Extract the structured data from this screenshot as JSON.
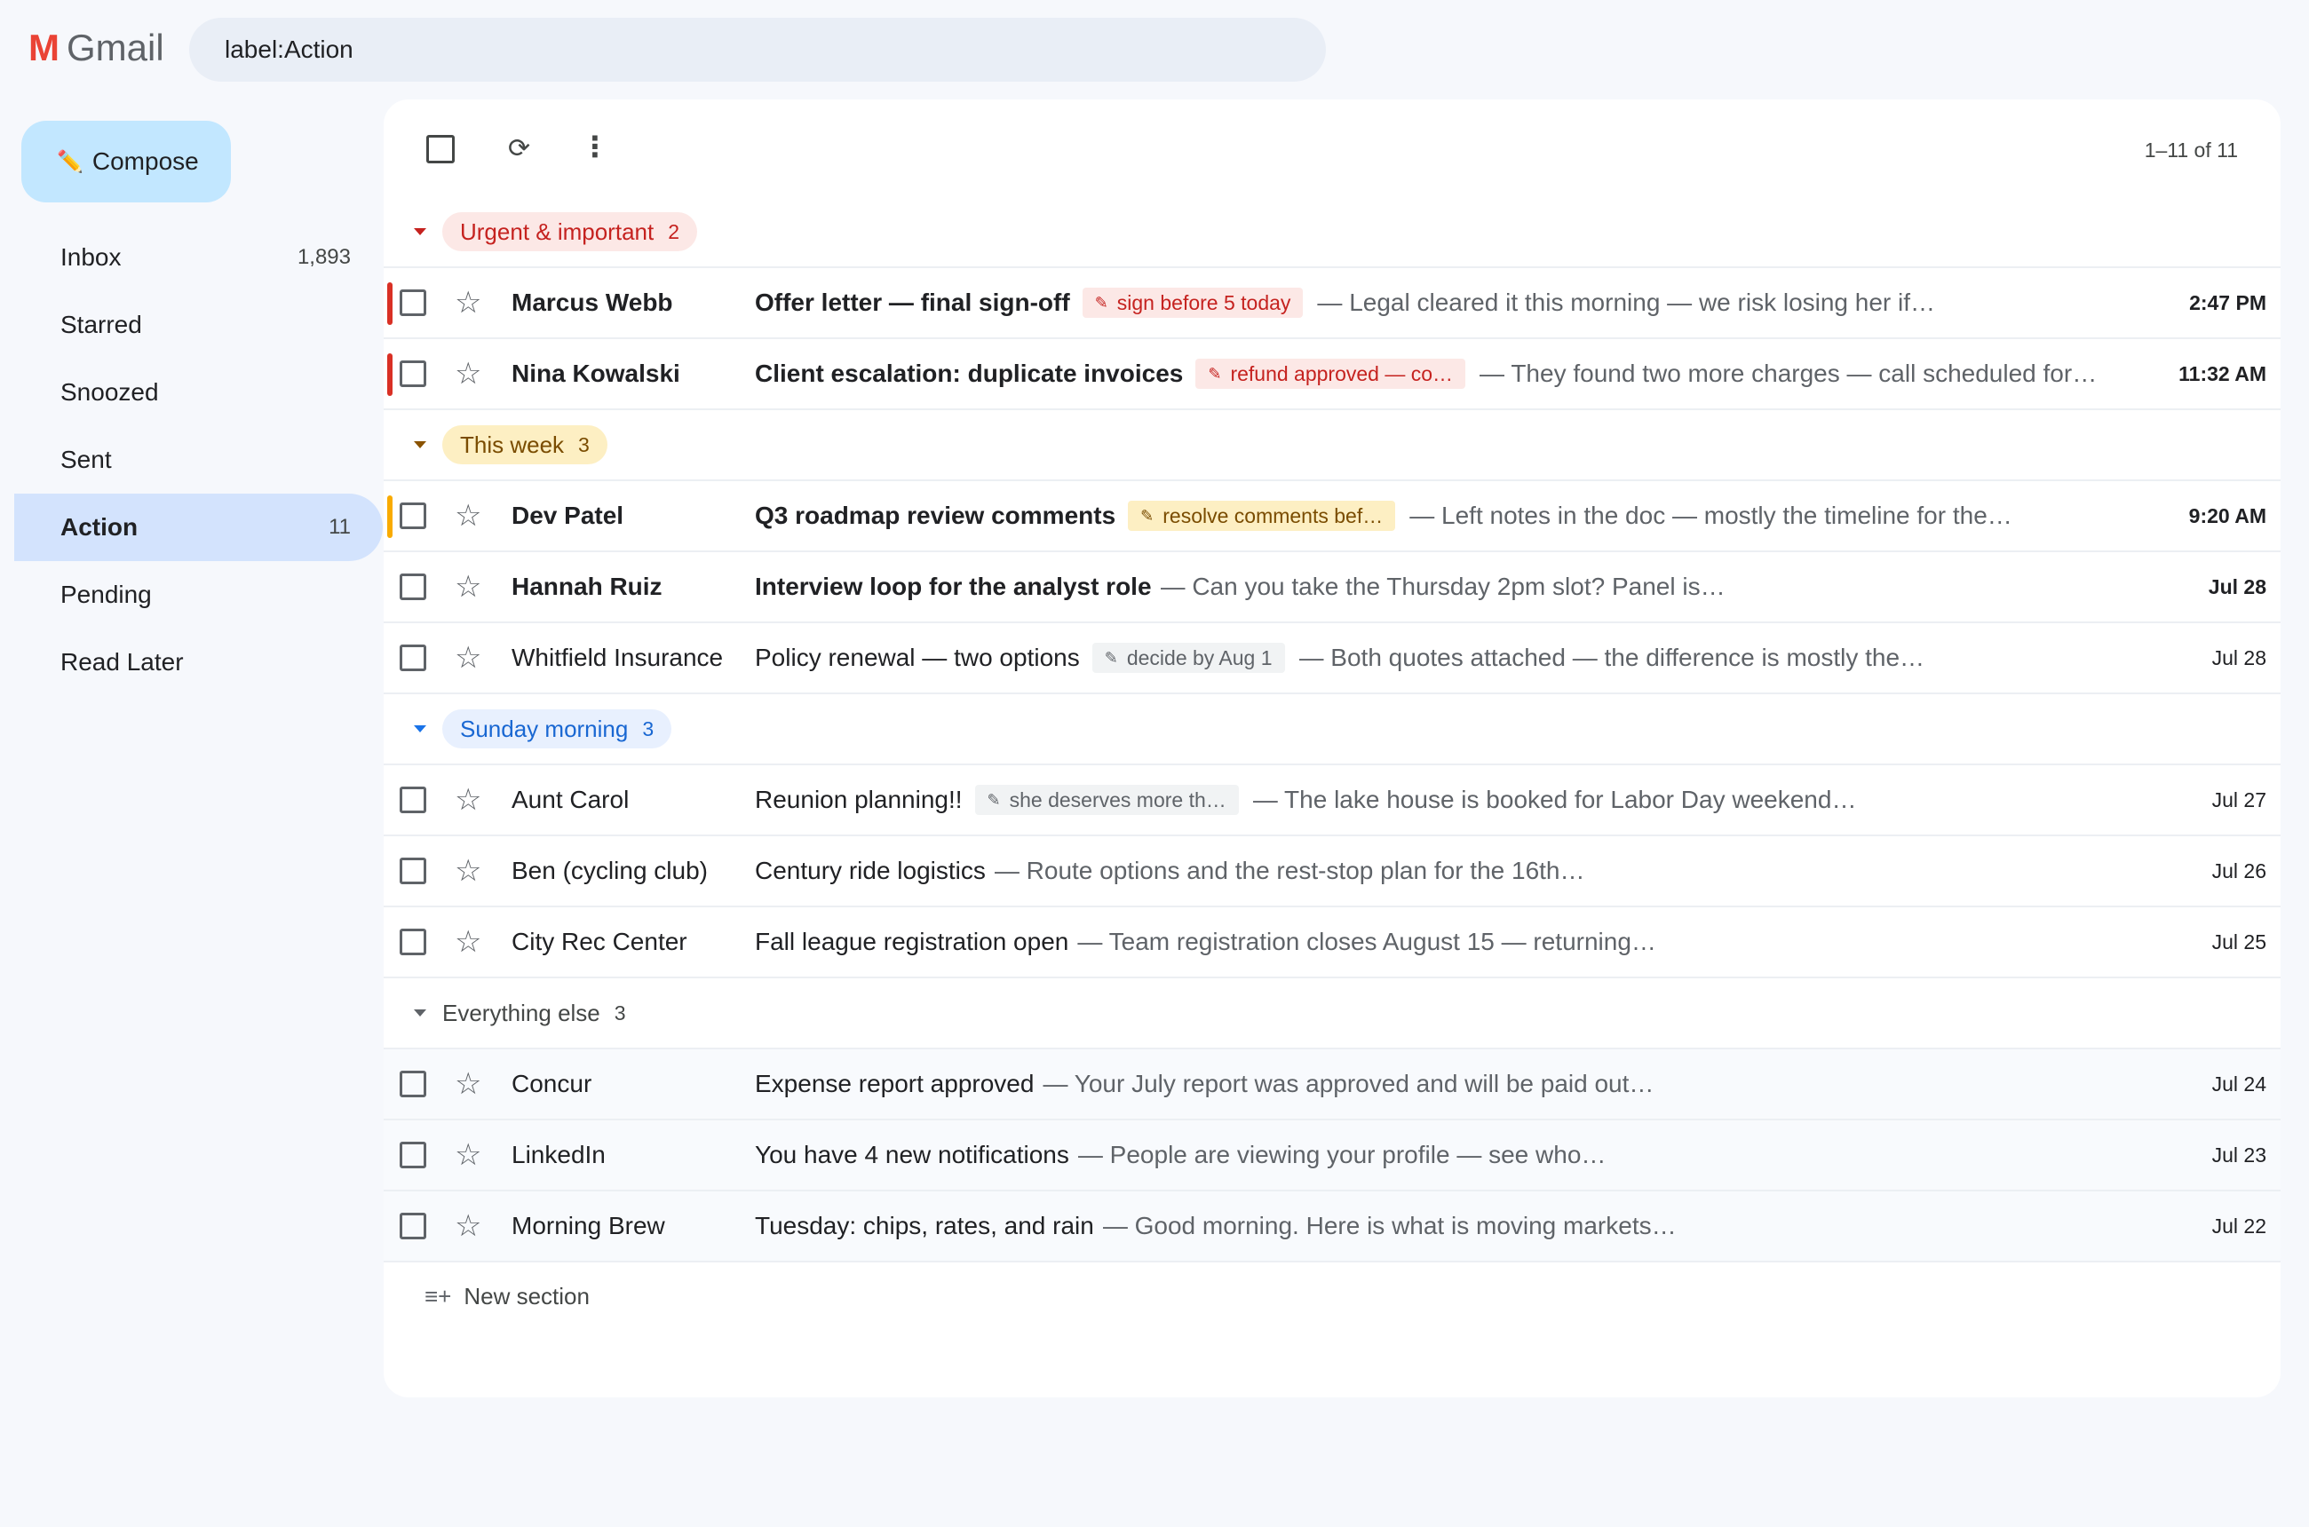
{
  "header": {
    "logo_letter": "M",
    "logo_text": "Gmail",
    "search_value": "label:Action"
  },
  "sidebar": {
    "compose_label": "Compose",
    "items": [
      {
        "label": "Inbox",
        "count": "1,893"
      },
      {
        "label": "Starred",
        "count": ""
      },
      {
        "label": "Snoozed",
        "count": ""
      },
      {
        "label": "Sent",
        "count": ""
      },
      {
        "label": "Action",
        "count": "11",
        "active": true
      },
      {
        "label": "Pending",
        "count": ""
      },
      {
        "label": "Read Later",
        "count": ""
      }
    ]
  },
  "toolbar": {
    "refresh_icon": "⟳",
    "more_icon": "⋮",
    "pager": "1–11 of 11"
  },
  "sections": [
    {
      "title": "Urgent & important",
      "count": "2",
      "color": "#c5221f",
      "rows": [
        {
          "sender": "Marcus Webb",
          "subject": "Offer letter — final sign-off",
          "tag": "sign before 5 today",
          "snippet": "— Legal cleared it this morning — we risk losing her if…",
          "date": "2:47 PM",
          "unread": true
        },
        {
          "sender": "Nina Kowalski",
          "subject": "Client escalation: duplicate invoices",
          "tag": "refund approved — co…",
          "snippet": "— They found two more charges — call scheduled for…",
          "date": "11:32 AM",
          "unread": true
        }
      ]
    },
    {
      "title": "This week",
      "count": "3",
      "color": "#f9ab00",
      "rows": [
        {
          "sender": "Dev Patel",
          "subject": "Q3 roadmap review comments",
          "tag": "resolve comments bef…",
          "snippet": "— Left notes in the doc — mostly the timeline for the…",
          "date": "9:20 AM",
          "unread": true
        },
        {
          "sender": "Hannah Ruiz",
          "subject": "Interview loop for the analyst role",
          "tag": "",
          "snippet": "— Can you take the Thursday 2pm slot? Panel is…",
          "date": "Jul 28",
          "unread": true
        },
        {
          "sender": "Whitfield Insurance",
          "subject": "Policy renewal — two options",
          "tag": "decide by Aug 1",
          "snippet": "— Both quotes attached — the difference is mostly the…",
          "date": "Jul 28",
          "unread": false
        }
      ]
    },
    {
      "title": "Sunday morning",
      "count": "3",
      "color": "#1a73e8",
      "rows": [
        {
          "sender": "Aunt Carol",
          "subject": "Reunion planning!!",
          "tag": "she deserves more th…",
          "snippet": "— The lake house is booked for Labor Day weekend…",
          "date": "Jul 27",
          "unread": false
        },
        {
          "sender": "Ben (cycling club)",
          "subject": "Century ride logistics",
          "tag": "",
          "snippet": "— Route options and the rest-stop plan for the 16th…",
          "date": "Jul 26",
          "unread": false
        },
        {
          "sender": "City Rec Center",
          "subject": "Fall league registration open",
          "tag": "",
          "snippet": "— Team registration closes August 15 — returning…",
          "date": "Jul 25",
          "unread": false
        }
      ]
    },
    {
      "title": "Everything else",
      "count": "3",
      "color": "#5f6368",
      "rows": [
        {
          "sender": "Concur",
          "subject": "Expense report approved",
          "tag": "",
          "snippet": "— Your July report was approved and will be paid out…",
          "date": "Jul 24",
          "unread": false
        },
        {
          "sender": "LinkedIn",
          "subject": "You have 4 new notifications",
          "tag": "",
          "snippet": "— People are viewing your profile — see who…",
          "date": "Jul 23",
          "unread": false
        },
        {
          "sender": "Morning Brew",
          "subject": "Tuesday: chips, rates, and rain",
          "tag": "",
          "snippet": "— Good morning. Here is what is moving markets…",
          "date": "Jul 22",
          "unread": false
        }
      ]
    }
  ],
  "new_section_label": "New section"
}
